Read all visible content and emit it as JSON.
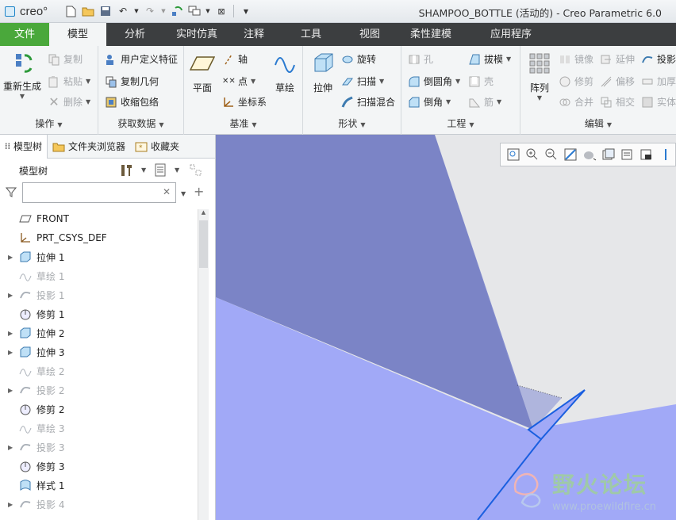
{
  "app": {
    "logo_text": "creo°",
    "window_title": "SHAMPOO_BOTTLE (活动的) - Creo Parametric 6.0"
  },
  "tabs": [
    {
      "label": "文件",
      "w": 62,
      "type": "file"
    },
    {
      "label": "模型",
      "w": 72,
      "type": "active"
    },
    {
      "label": "分析",
      "w": 72
    },
    {
      "label": "实时仿真",
      "w": 84
    },
    {
      "label": "注释",
      "w": 60
    },
    {
      "label": "工具",
      "w": 84
    },
    {
      "label": "视图",
      "w": 64
    },
    {
      "label": "柔性建模",
      "w": 90
    },
    {
      "label": "应用程序",
      "w": 112
    }
  ],
  "ribbon": {
    "operations": {
      "label": "操作",
      "regenerate": "重新生成",
      "copy": "复制",
      "paste": "粘贴",
      "delete": "删除"
    },
    "get_data": {
      "label": "获取数据",
      "udf": "用户定义特征",
      "copy_geom": "复制几何",
      "shrinkwrap": "收缩包络"
    },
    "datum": {
      "label": "基准",
      "plane": "平面",
      "axis": "轴",
      "point": "点",
      "csys": "坐标系",
      "sketch": "草绘"
    },
    "shapes": {
      "label": "形状",
      "extrude": "拉伸",
      "revolve": "旋转",
      "sweep": "扫描",
      "swept_blend": "扫描混合"
    },
    "engineering": {
      "label": "工程",
      "hole": "孔",
      "draft": "拔模",
      "round": "倒圆角",
      "shell": "壳",
      "chamfer": "倒角",
      "rib": "筋"
    },
    "editing": {
      "label": "编辑",
      "pattern": "阵列",
      "mirror": "镜像",
      "extend": "延伸",
      "project": "投影",
      "trim": "修剪",
      "offset": "偏移",
      "thicken": "加厚",
      "merge": "合并",
      "intersect": "相交",
      "solidify": "实体"
    }
  },
  "panel": {
    "tabs": [
      "模型树",
      "文件夹浏览器",
      "收藏夹"
    ],
    "tree_title": "模型树",
    "search_placeholder": ""
  },
  "tree_items": [
    {
      "label": "FRONT",
      "icon": "plane-icon",
      "expandable": false,
      "dim": false
    },
    {
      "label": "PRT_CSYS_DEF",
      "icon": "csys-icon",
      "expandable": false,
      "dim": false
    },
    {
      "label": "拉伸 1",
      "icon": "extrude-icon",
      "expandable": true,
      "dim": false
    },
    {
      "label": "草绘 1",
      "icon": "sketch-icon",
      "expandable": false,
      "dim": true
    },
    {
      "label": "投影 1",
      "icon": "project-icon",
      "expandable": true,
      "dim": true
    },
    {
      "label": "修剪 1",
      "icon": "trim-icon",
      "expandable": false,
      "dim": false
    },
    {
      "label": "拉伸 2",
      "icon": "extrude-icon",
      "expandable": true,
      "dim": false
    },
    {
      "label": "拉伸 3",
      "icon": "extrude-icon",
      "expandable": true,
      "dim": false
    },
    {
      "label": "草绘 2",
      "icon": "sketch-icon",
      "expandable": false,
      "dim": true
    },
    {
      "label": "投影 2",
      "icon": "project-icon",
      "expandable": true,
      "dim": true
    },
    {
      "label": "修剪 2",
      "icon": "trim-icon",
      "expandable": false,
      "dim": false
    },
    {
      "label": "草绘 3",
      "icon": "sketch-icon",
      "expandable": false,
      "dim": true
    },
    {
      "label": "投影 3",
      "icon": "project-icon",
      "expandable": true,
      "dim": true
    },
    {
      "label": "修剪 3",
      "icon": "trim-icon",
      "expandable": false,
      "dim": false
    },
    {
      "label": "样式 1",
      "icon": "style-icon",
      "expandable": false,
      "dim": false
    },
    {
      "label": "投影 4",
      "icon": "project-icon",
      "expandable": true,
      "dim": true
    }
  ],
  "watermark": {
    "title": "野火论坛",
    "url": "www.proewildfire.cn"
  },
  "colors": {
    "file_tab": "#4aa83b",
    "tabbar": "#3c3e40",
    "surface_light": "#a1a9f7",
    "surface_dark": "#7b84c6",
    "edge": "#1a5fe0"
  }
}
